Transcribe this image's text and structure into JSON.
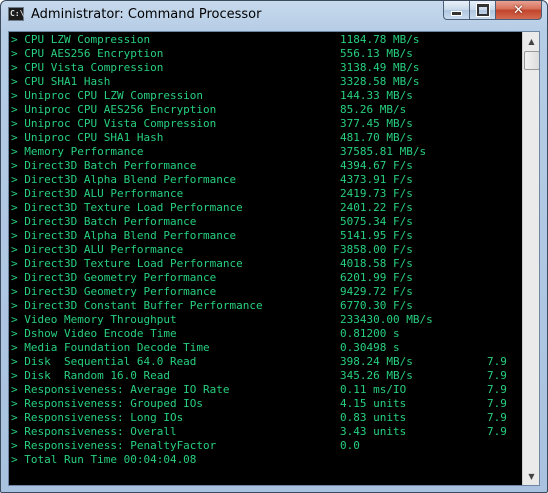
{
  "window": {
    "title": "Administrator: Command Processor",
    "icon": "C:\\",
    "buttons": {
      "minimize": "minimize-icon",
      "maximize": "maximize-icon",
      "close": "close-icon"
    }
  },
  "console": {
    "text_color": "#27d07e",
    "background": "#000000",
    "lines": [
      {
        "label": "> CPU LZW Compression",
        "value": "1184.78 MB/s",
        "score": ""
      },
      {
        "label": "> CPU AES256 Encryption",
        "value": "556.13 MB/s",
        "score": ""
      },
      {
        "label": "> CPU Vista Compression",
        "value": "3138.49 MB/s",
        "score": ""
      },
      {
        "label": "> CPU SHA1 Hash",
        "value": "3328.58 MB/s",
        "score": ""
      },
      {
        "label": "> Uniproc CPU LZW Compression",
        "value": "144.33 MB/s",
        "score": ""
      },
      {
        "label": "> Uniproc CPU AES256 Encryption",
        "value": "85.26 MB/s",
        "score": ""
      },
      {
        "label": "> Uniproc CPU Vista Compression",
        "value": "377.45 MB/s",
        "score": ""
      },
      {
        "label": "> Uniproc CPU SHA1 Hash",
        "value": "481.70 MB/s",
        "score": ""
      },
      {
        "label": "> Memory Performance",
        "value": "37585.81 MB/s",
        "score": ""
      },
      {
        "label": "> Direct3D Batch Performance",
        "value": "4394.67 F/s",
        "score": ""
      },
      {
        "label": "> Direct3D Alpha Blend Performance",
        "value": "4373.91 F/s",
        "score": ""
      },
      {
        "label": "> Direct3D ALU Performance",
        "value": "2419.73 F/s",
        "score": ""
      },
      {
        "label": "> Direct3D Texture Load Performance",
        "value": "2401.22 F/s",
        "score": ""
      },
      {
        "label": "> Direct3D Batch Performance",
        "value": "5075.34 F/s",
        "score": ""
      },
      {
        "label": "> Direct3D Alpha Blend Performance",
        "value": "5141.95 F/s",
        "score": ""
      },
      {
        "label": "> Direct3D ALU Performance",
        "value": "3858.00 F/s",
        "score": ""
      },
      {
        "label": "> Direct3D Texture Load Performance",
        "value": "4018.58 F/s",
        "score": ""
      },
      {
        "label": "> Direct3D Geometry Performance",
        "value": "6201.99 F/s",
        "score": ""
      },
      {
        "label": "> Direct3D Geometry Performance",
        "value": "9429.72 F/s",
        "score": ""
      },
      {
        "label": "> Direct3D Constant Buffer Performance",
        "value": "6770.30 F/s",
        "score": ""
      },
      {
        "label": "> Video Memory Throughput",
        "value": "233430.00 MB/s",
        "score": ""
      },
      {
        "label": "> Dshow Video Encode Time",
        "value": "0.81200 s",
        "score": ""
      },
      {
        "label": "> Media Foundation Decode Time",
        "value": "0.30498 s",
        "score": ""
      },
      {
        "label": "> Disk  Sequential 64.0 Read",
        "value": "398.24 MB/s",
        "score": "7.9"
      },
      {
        "label": "> Disk  Random 16.0 Read",
        "value": "345.26 MB/s",
        "score": "7.9"
      },
      {
        "label": "> Responsiveness: Average IO Rate",
        "value": "0.11 ms/IO",
        "score": "7.9"
      },
      {
        "label": "> Responsiveness: Grouped IOs",
        "value": "4.15 units",
        "score": "7.9"
      },
      {
        "label": "> Responsiveness: Long IOs",
        "value": "0.83 units",
        "score": "7.9"
      },
      {
        "label": "> Responsiveness: Overall",
        "value": "3.43 units",
        "score": "7.9"
      },
      {
        "label": "> Responsiveness: PenaltyFactor",
        "value": "0.0",
        "score": ""
      },
      {
        "label": "> Total Run Time 00:04:04.08",
        "value": "",
        "score": ""
      },
      {
        "label": "",
        "value": "",
        "score": ""
      }
    ]
  },
  "scrollbar": {
    "up_icon": "scroll-up-arrow-icon",
    "down_icon": "scroll-down-arrow-icon"
  }
}
